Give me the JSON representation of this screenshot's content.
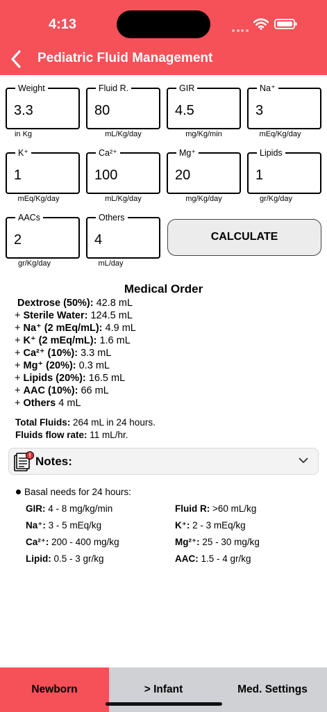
{
  "status": {
    "time": "4:13"
  },
  "nav": {
    "title": "Pediatric Fluid Management"
  },
  "fields": [
    {
      "label": "Weight",
      "value": "3.3",
      "unit": "in Kg"
    },
    {
      "label": "Fluid R.",
      "value": "80",
      "unit": "mL/Kg/day"
    },
    {
      "label": "GIR",
      "value": "4.5",
      "unit": "mg/Kg/min"
    },
    {
      "label": "Na⁺",
      "value": "3",
      "unit": "mEq/Kg/day"
    },
    {
      "label": "K⁺",
      "value": "1",
      "unit": "mEq/Kg/day"
    },
    {
      "label": "Ca²⁺",
      "value": "100",
      "unit": "mL/Kg/day"
    },
    {
      "label": "Mg⁺",
      "value": "20",
      "unit": "mg/Kg/day"
    },
    {
      "label": "Lipids",
      "value": "1",
      "unit": "gr/Kg/day"
    },
    {
      "label": "AACs",
      "value": "2",
      "unit": "gr/Kg/day"
    },
    {
      "label": "Others",
      "value": "4",
      "unit": "mL/day"
    }
  ],
  "calculate_label": "CALCULATE",
  "order": {
    "title": "Medical Order",
    "lines": [
      {
        "prefix": "",
        "label": "Dextrose (50%):",
        "value": " 42.8 mL"
      },
      {
        "prefix": "+ ",
        "label": "Sterile Water:",
        "value": " 124.5 mL"
      },
      {
        "prefix": "+ ",
        "label": "Na⁺ (2 mEq/mL):",
        "value": " 4.9 mL"
      },
      {
        "prefix": "+ ",
        "label": "K⁺ (2 mEq/mL):",
        "value": " 1.6 mL"
      },
      {
        "prefix": "+ ",
        "label": "Ca²⁺ (10%):",
        "value": " 3.3 mL"
      },
      {
        "prefix": "+ ",
        "label": "Mg⁺ (20%):",
        "value": " 0.3 mL"
      },
      {
        "prefix": "+ ",
        "label": "Lipids (20%):",
        "value": " 16.5 mL"
      },
      {
        "prefix": "+ ",
        "label": "AAC (10%):",
        "value": " 66 mL"
      },
      {
        "prefix": "+ ",
        "label": "Others",
        "value": " 4 mL"
      }
    ],
    "total_label": "Total Fluids:",
    "total_value": " 264 mL in 24 hours.",
    "flow_label": "Fluids flow rate:",
    "flow_value": " 11 mL/hr."
  },
  "notes": {
    "label": "Notes:",
    "badge": "!",
    "basal_title": "Basal needs for 24 hours:",
    "needs": [
      {
        "label": "GIR:",
        "value": " 4 - 8 mg/kg/min"
      },
      {
        "label": "Fluid R:",
        "value": " >60 mL/kg"
      },
      {
        "label": "Na⁺:",
        "value": " 3 - 5 mEq/kg"
      },
      {
        "label": "K⁺:",
        "value": " 2 - 3 mEq/kg"
      },
      {
        "label": "Ca²⁺:",
        "value": " 200 - 400 mg/kg"
      },
      {
        "label": "Mg²⁺:",
        "value": " 25 - 30 mg/kg"
      },
      {
        "label": "Lipid:",
        "value": " 0.5 - 3 gr/kg"
      },
      {
        "label": "AAC:",
        "value": " 1.5 - 4 gr/kg"
      }
    ]
  },
  "tabs": [
    {
      "label": "Newborn"
    },
    {
      "label": "> Infant"
    },
    {
      "label": "Med. Settings"
    }
  ],
  "colors": {
    "accent": "#f65058",
    "tab_inactive": "#cfd1d4"
  }
}
